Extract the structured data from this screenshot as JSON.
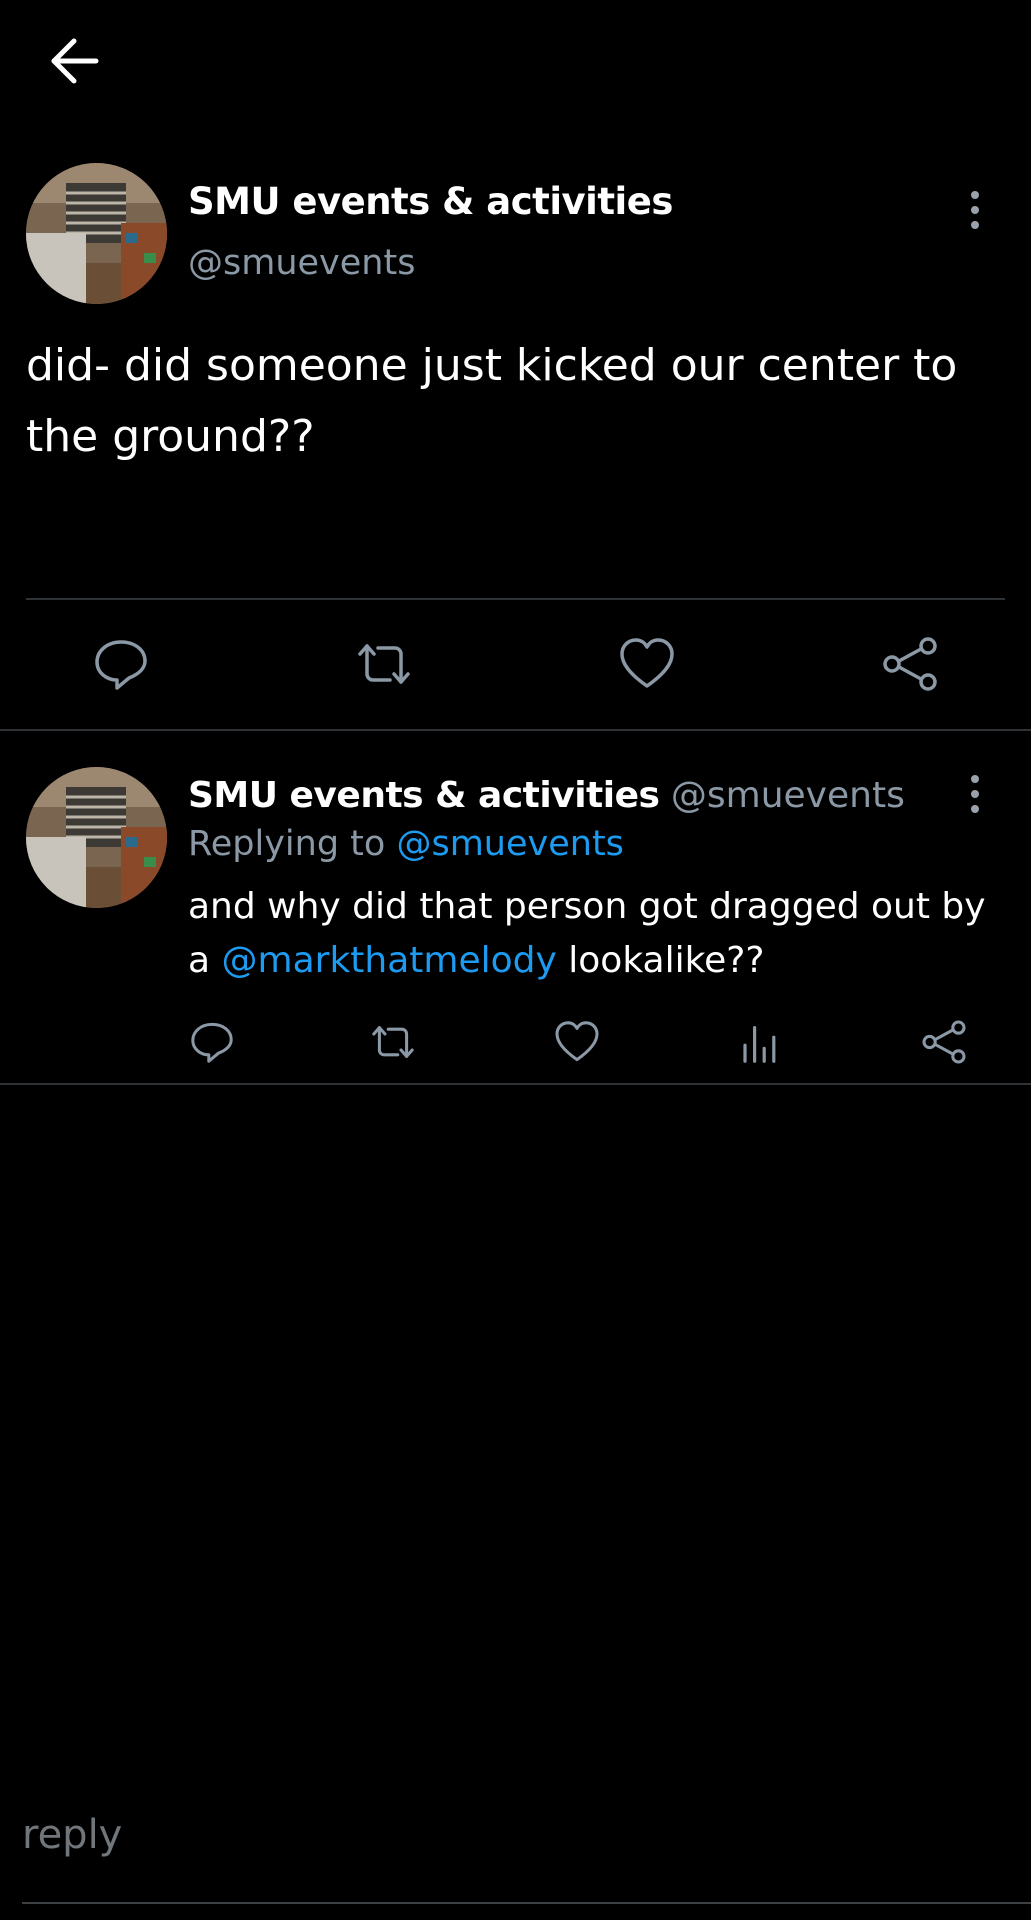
{
  "header": {
    "back_icon": "arrow-left-icon"
  },
  "main_tweet": {
    "name": "SMU events & activities",
    "handle": "@smuevents",
    "text": "did- did someone just kicked our center to the ground??",
    "actions": [
      "reply-icon",
      "retweet-icon",
      "like-icon",
      "share-icon"
    ]
  },
  "reply_tweet": {
    "name": "SMU events & activities",
    "handle": "@smuevents",
    "replying_prefix": "Replying to",
    "replying_to": "@smuevents",
    "text_before": "and why did that person got dragged out by a",
    "mention": "@markthatmelody",
    "text_after": "lookalike??",
    "actions": [
      "reply-icon",
      "retweet-icon",
      "like-icon",
      "analytics-icon",
      "share-icon"
    ]
  },
  "composer": {
    "placeholder": "reply"
  },
  "colors": {
    "background": "#000000",
    "text": "#ffffff",
    "muted": "#8b98a5",
    "link": "#1d9bf0",
    "divider": "#2f3336"
  }
}
